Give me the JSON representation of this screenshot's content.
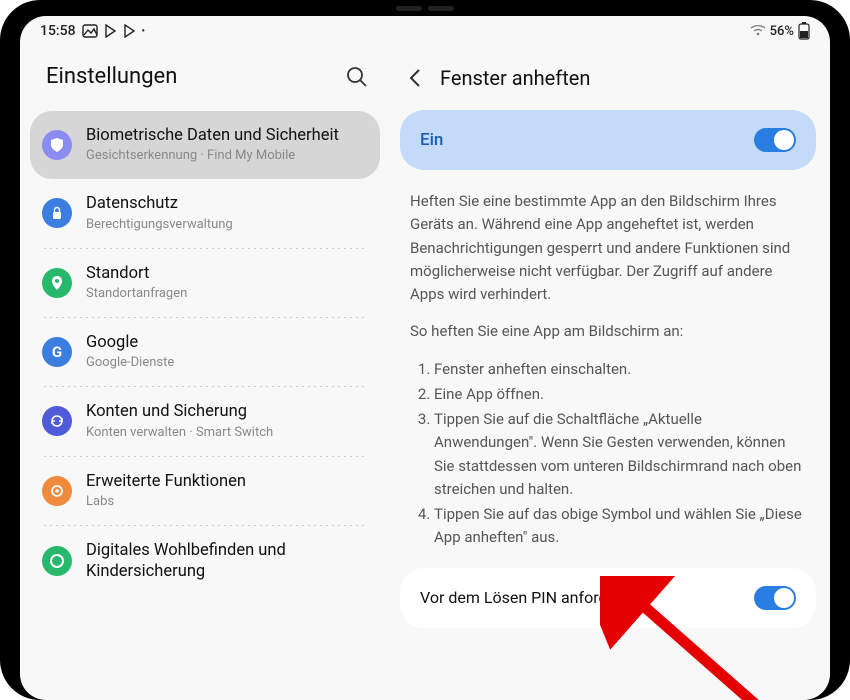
{
  "status": {
    "time": "15:58",
    "battery": "56%"
  },
  "leftHeader": {
    "title": "Einstellungen"
  },
  "sidebar": {
    "items": [
      {
        "title": "Biometrische Daten und Sicherheit",
        "sub": "Gesichtserkennung · Find My Mobile",
        "color": "#8b8cf0"
      },
      {
        "title": "Datenschutz",
        "sub": "Berechtigungsverwaltung",
        "color": "#3c7de0"
      },
      {
        "title": "Standort",
        "sub": "Standortanfragen",
        "color": "#28b86b"
      },
      {
        "title": "Google",
        "sub": "Google-Dienste",
        "color": "#3c7de0"
      },
      {
        "title": "Konten und Sicherung",
        "sub": "Konten verwalten · Smart Switch",
        "color": "#4f5bd8"
      },
      {
        "title": "Erweiterte Funktionen",
        "sub": "Labs",
        "color": "#f08a3c"
      },
      {
        "title": "Digitales Wohlbefinden und Kindersicherung",
        "sub": "",
        "color": "#28b86b"
      }
    ]
  },
  "detail": {
    "headerTitle": "Fenster anheften",
    "onLabel": "Ein",
    "desc": "Heften Sie eine bestimmte App an den Bildschirm Ihres Geräts an. Während eine App angeheftet ist, werden Benachrichtigungen gesperrt und andere Funktionen sind möglicherweise nicht verfügbar. Der Zugriff auf andere Apps wird verhindert.",
    "howTitle": "So heften Sie eine App am Bildschirm an:",
    "steps": [
      "Fenster anheften einschalten.",
      "Eine App öffnen.",
      "Tippen Sie auf die Schaltfläche „Aktuelle Anwendungen\". Wenn Sie Gesten verwenden, können Sie stattdessen vom unteren Bildschirmrand nach oben streichen und halten.",
      "Tippen Sie auf das obige Symbol und wählen Sie „Diese App anheften\" aus."
    ],
    "pinLabel": "Vor dem Lösen PIN anfordern"
  }
}
